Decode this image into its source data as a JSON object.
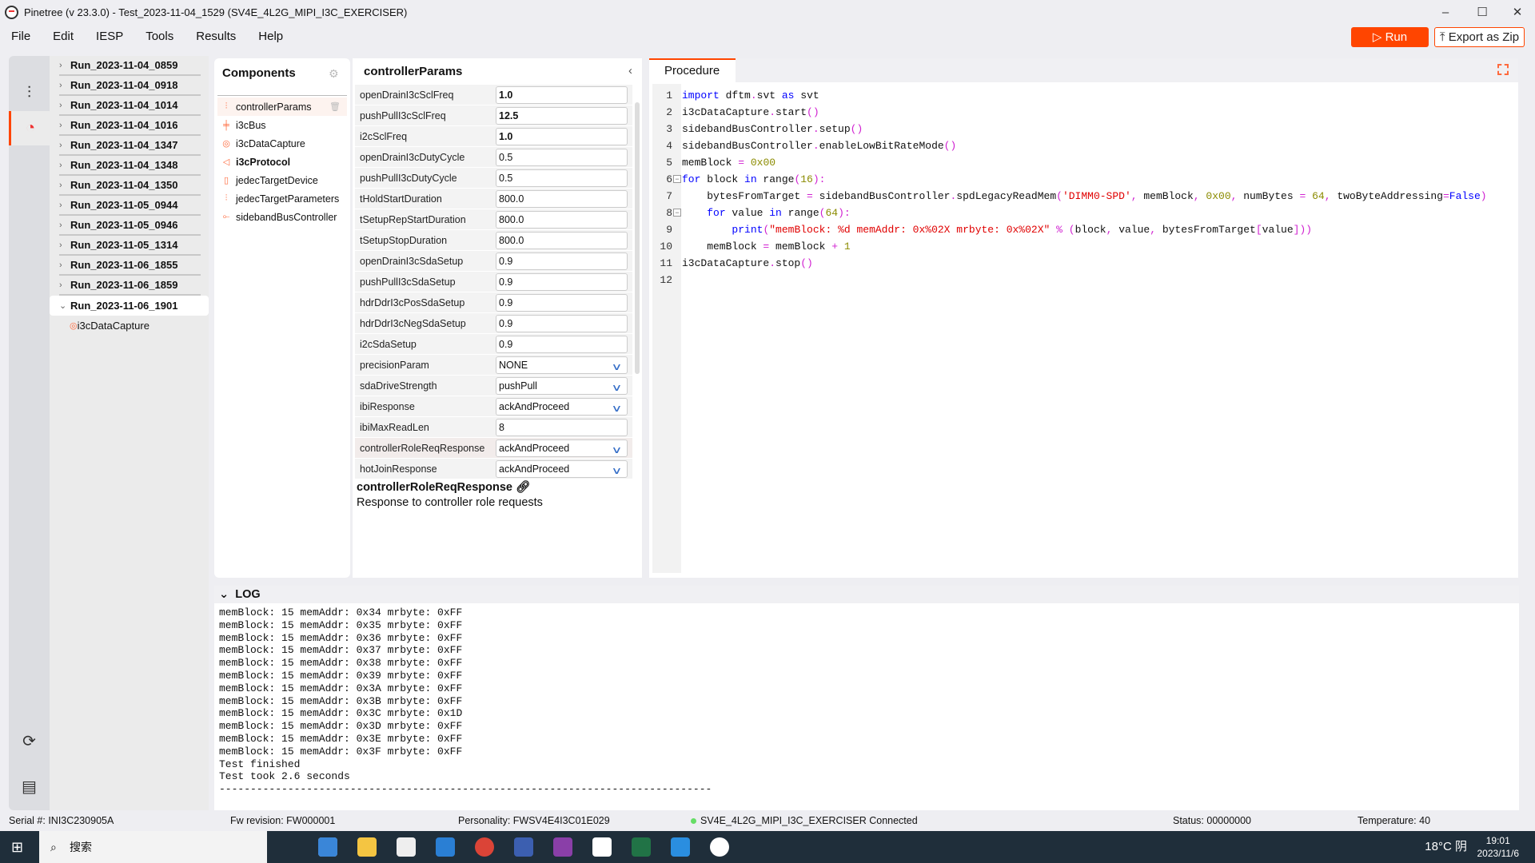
{
  "window": {
    "title": "Pinetree (v 23.3.0) - Test_2023-11-04_1529 (SV4E_4L2G_MIPI_I3C_EXERCISER)",
    "min": "–",
    "max": "☐",
    "close": "✕"
  },
  "menu": [
    "File",
    "Edit",
    "IESP",
    "Tools",
    "Results",
    "Help"
  ],
  "toolbar": {
    "run": "▷ Run",
    "export": "⤒ Export as Zip"
  },
  "rail": {
    "icons": [
      "sliders-icon",
      "pie-chart-icon",
      "refresh-icon",
      "document-icon"
    ]
  },
  "runs": [
    {
      "label": "Run_2023-11-04_0859"
    },
    {
      "label": "Run_2023-11-04_0918"
    },
    {
      "label": "Run_2023-11-04_1014"
    },
    {
      "label": "Run_2023-11-04_1016"
    },
    {
      "label": "Run_2023-11-04_1347"
    },
    {
      "label": "Run_2023-11-04_1348"
    },
    {
      "label": "Run_2023-11-04_1350"
    },
    {
      "label": "Run_2023-11-05_0944"
    },
    {
      "label": "Run_2023-11-05_0946"
    },
    {
      "label": "Run_2023-11-05_1314"
    },
    {
      "label": "Run_2023-11-06_1855"
    },
    {
      "label": "Run_2023-11-06_1859"
    },
    {
      "label": "Run_2023-11-06_1901",
      "expanded": true,
      "children": [
        "i3cDataCapture"
      ]
    }
  ],
  "components": {
    "title": "Components",
    "items": [
      {
        "label": "controllerParams",
        "icon": "sliders-icon",
        "selected": true
      },
      {
        "label": "i3cBus",
        "icon": "bus-icon"
      },
      {
        "label": "i3cDataCapture",
        "icon": "capture-icon"
      },
      {
        "label": "i3cProtocol",
        "icon": "megaphone-icon",
        "bold": true
      },
      {
        "label": "jedecTargetDevice",
        "icon": "device-icon"
      },
      {
        "label": "jedecTargetParameters",
        "icon": "sliders-icon"
      },
      {
        "label": "sidebandBusController",
        "icon": "controller-icon"
      }
    ]
  },
  "params": {
    "title": "controllerParams",
    "rows": [
      {
        "label": "openDrainI3cSclFreq",
        "value": "1.0",
        "bold": true
      },
      {
        "label": "pushPullI3cSclFreq",
        "value": "12.5",
        "bold": true
      },
      {
        "label": "i2cSclFreq",
        "value": "1.0",
        "bold": true
      },
      {
        "label": "openDrainI3cDutyCycle",
        "value": "0.5"
      },
      {
        "label": "pushPullI3cDutyCycle",
        "value": "0.5"
      },
      {
        "label": "tHoldStartDuration",
        "value": "800.0"
      },
      {
        "label": "tSetupRepStartDuration",
        "value": "800.0"
      },
      {
        "label": "tSetupStopDuration",
        "value": "800.0"
      },
      {
        "label": "openDrainI3cSdaSetup",
        "value": "0.9"
      },
      {
        "label": "pushPullI3cSdaSetup",
        "value": "0.9"
      },
      {
        "label": "hdrDdrI3cPosSdaSetup",
        "value": "0.9"
      },
      {
        "label": "hdrDdrI3cNegSdaSetup",
        "value": "0.9"
      },
      {
        "label": "i2cSdaSetup",
        "value": "0.9"
      },
      {
        "label": "precisionParam",
        "value": "NONE",
        "dropdown": true
      },
      {
        "label": "sdaDriveStrength",
        "value": "pushPull",
        "dropdown": true
      },
      {
        "label": "ibiResponse",
        "value": "ackAndProceed",
        "dropdown": true
      },
      {
        "label": "ibiMaxReadLen",
        "value": "8"
      },
      {
        "label": "controllerRoleReqResponse",
        "value": "ackAndProceed",
        "dropdown": true,
        "highlight": true
      },
      {
        "label": "hotJoinResponse",
        "value": "ackAndProceed",
        "dropdown": true
      }
    ],
    "help_title": "controllerRoleReqResponse",
    "help_desc": "Response to controller role requests"
  },
  "procedure": {
    "tab": "Procedure",
    "lines": [
      "<span class=\"kw\">import</span> dftm<span class=\"op\">.</span>svt <span class=\"kw\">as</span> svt",
      "i3cDataCapture<span class=\"op\">.</span>start<span class=\"op\">()</span>",
      "sidebandBusController<span class=\"op\">.</span>setup<span class=\"op\">()</span>",
      "sidebandBusController<span class=\"op\">.</span>enableLowBitRateMode<span class=\"op\">()</span>",
      "memBlock <span class=\"op\">=</span> <span class=\"num\">0x00</span>",
      "<span class=\"kw\">for</span> block <span class=\"kw\">in</span> range<span class=\"op\">(</span><span class=\"num\">16</span><span class=\"op\">):</span>",
      "    bytesFromTarget <span class=\"op\">=</span> sidebandBusController<span class=\"op\">.</span>spdLegacyReadMem<span class=\"op\">(</span><span class=\"str\">'DIMM0-SPD'</span><span class=\"op\">,</span> memBlock<span class=\"op\">,</span> <span class=\"num\">0x00</span><span class=\"op\">,</span> numBytes <span class=\"op\">=</span> <span class=\"num\">64</span><span class=\"op\">,</span> twoByteAddressing<span class=\"op\">=</span><span class=\"kw\">False</span><span class=\"op\">)</span>",
      "    <span class=\"kw\">for</span> value <span class=\"kw\">in</span> range<span class=\"op\">(</span><span class=\"num\">64</span><span class=\"op\">):</span>",
      "        <span class=\"kw\">print</span><span class=\"op\">(</span><span class=\"str\">\"memBlock: %d memAddr: 0x%02X mrbyte: 0x%02X\"</span> <span class=\"op\">%</span> <span class=\"op\">(</span>block<span class=\"op\">,</span> value<span class=\"op\">,</span> bytesFromTarget<span class=\"op\">[</span>value<span class=\"op\">]))</span>",
      "    memBlock <span class=\"op\">=</span> memBlock <span class=\"op\">+</span> <span class=\"num\">1</span>",
      "i3cDataCapture<span class=\"op\">.</span>stop<span class=\"op\">()</span>",
      ""
    ]
  },
  "log": {
    "title": "LOG",
    "lines": [
      "memBlock: 15 memAddr: 0x34 mrbyte: 0xFF",
      "memBlock: 15 memAddr: 0x35 mrbyte: 0xFF",
      "memBlock: 15 memAddr: 0x36 mrbyte: 0xFF",
      "memBlock: 15 memAddr: 0x37 mrbyte: 0xFF",
      "memBlock: 15 memAddr: 0x38 mrbyte: 0xFF",
      "memBlock: 15 memAddr: 0x39 mrbyte: 0xFF",
      "memBlock: 15 memAddr: 0x3A mrbyte: 0xFF",
      "memBlock: 15 memAddr: 0x3B mrbyte: 0xFF",
      "memBlock: 15 memAddr: 0x3C mrbyte: 0x1D",
      "memBlock: 15 memAddr: 0x3D mrbyte: 0xFF",
      "memBlock: 15 memAddr: 0x3E mrbyte: 0xFF",
      "memBlock: 15 memAddr: 0x3F mrbyte: 0xFF",
      "Test finished",
      "Test took 2.6 seconds",
      "-------------------------------------------------------------------------------"
    ]
  },
  "status": {
    "serial": "Serial #:   INI3C230905A",
    "fw": "Fw revision: FW000001",
    "personality": "Personality: FWSV4E4I3C01E029",
    "connection": "SV4E_4L2G_MIPI_I3C_EXERCISER  Connected",
    "status": "Status: 00000000",
    "temperature": "Temperature: 40"
  },
  "taskbar": {
    "search": "搜索",
    "weather": "18°C 阴",
    "time": "19:01",
    "date": "2023/11/6"
  },
  "colors": {
    "accent": "#ff4500",
    "connected": "#66dd66"
  }
}
